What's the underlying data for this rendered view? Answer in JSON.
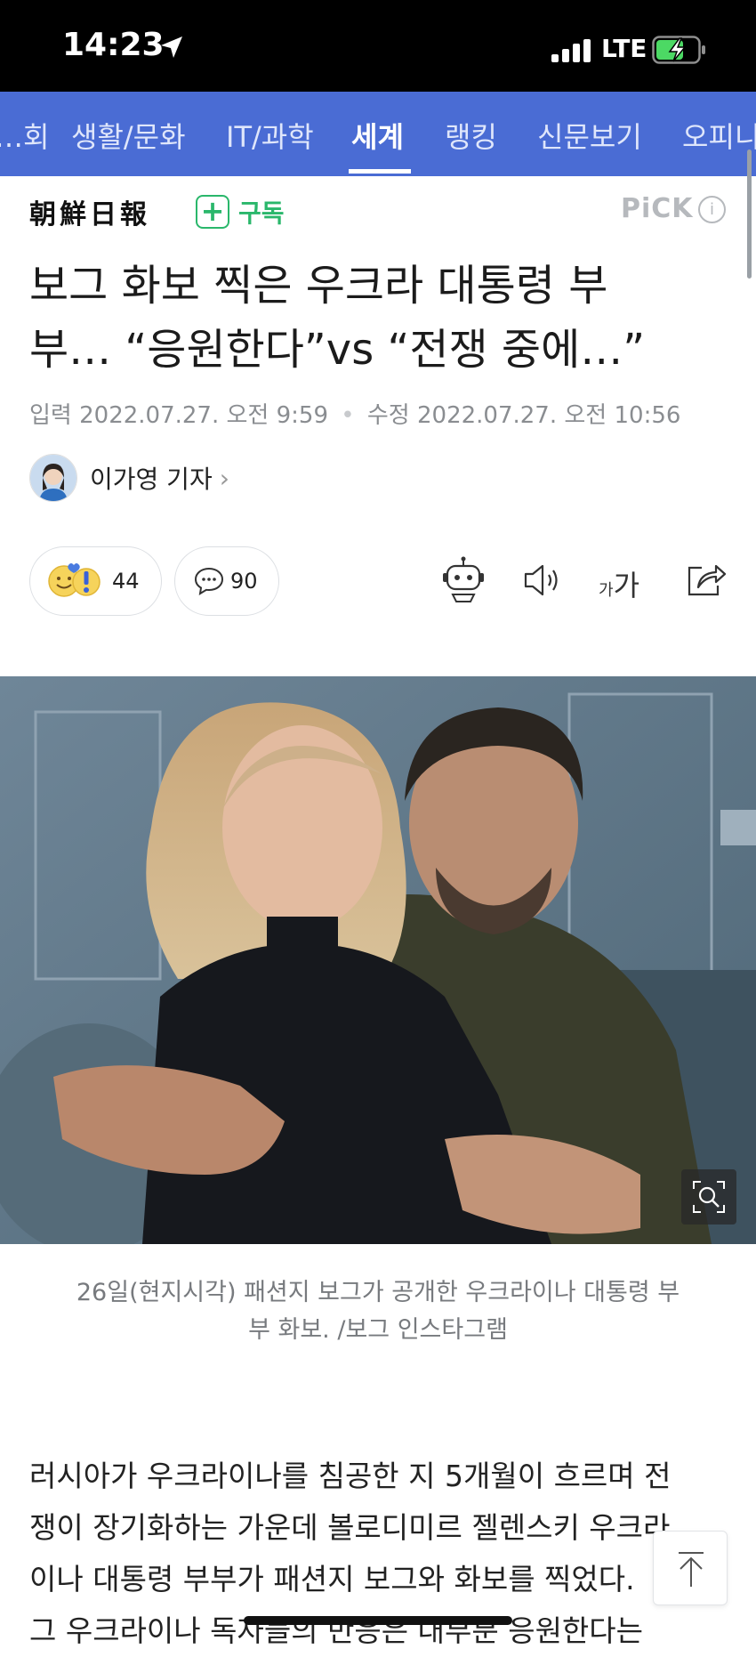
{
  "status": {
    "time": "14:23",
    "network": "LTE"
  },
  "nav": {
    "categories": [
      "사회",
      "생활/문화",
      "IT/과학",
      "세계",
      "랭킹",
      "신문보기",
      "오피니언"
    ],
    "visible_labels": [
      "…회",
      "생활/문화",
      "IT/과학",
      "세계",
      "랭킹",
      "신문보기",
      "오피니"
    ],
    "active": "세계"
  },
  "press": {
    "name": "朝鮮日報",
    "subscribe_label": "구독",
    "pick_label": "PiCK"
  },
  "article": {
    "headline_line1": "보그 화보 찍은 우크라 대통령 부",
    "headline_line2": "부… “응원한다”vs “전쟁 중에…”",
    "input_label": "입력",
    "input_date": "2022.07.27. 오전 9:59",
    "modified_label": "수정",
    "modified_date": "2022.07.27. 오전 10:56",
    "author": "이가영 기자",
    "reactions_count": "44",
    "comments_count": "90",
    "caption_line1": "26일(현지시각) 패션지 보그가 공개한 우크라이나 대통령 부",
    "caption_line2": "부 화보. /보그 인스타그램",
    "body_line1": "러시아가 우크라이나를 침공한 지 5개월이 흐르며 전",
    "body_line2": "쟁이 장기화하는 가운데 볼로디미르 젤렌스키 우크라",
    "body_line3": "이나 대통령 부부가 패션지 보그와 화보를 찍었다.",
    "body_line4": "그 우크라이나 독자들의 반응은 대부분 응원한다는"
  },
  "toolbar": {
    "font_small": "가",
    "font_big": "가"
  },
  "colors": {
    "nav_bg": "#4a6cd4",
    "subscribe": "#2ab76b",
    "pick": "#b6b9bd"
  },
  "icons": [
    "location-arrow-icon",
    "signal-icon",
    "battery-charging-icon",
    "plus-icon",
    "info-icon",
    "smile-emoji-icon",
    "exclamation-icon",
    "comment-icon",
    "robot-summary-icon",
    "speaker-icon",
    "font-size-icon",
    "share-icon",
    "zoom-icon",
    "arrow-up-icon"
  ]
}
